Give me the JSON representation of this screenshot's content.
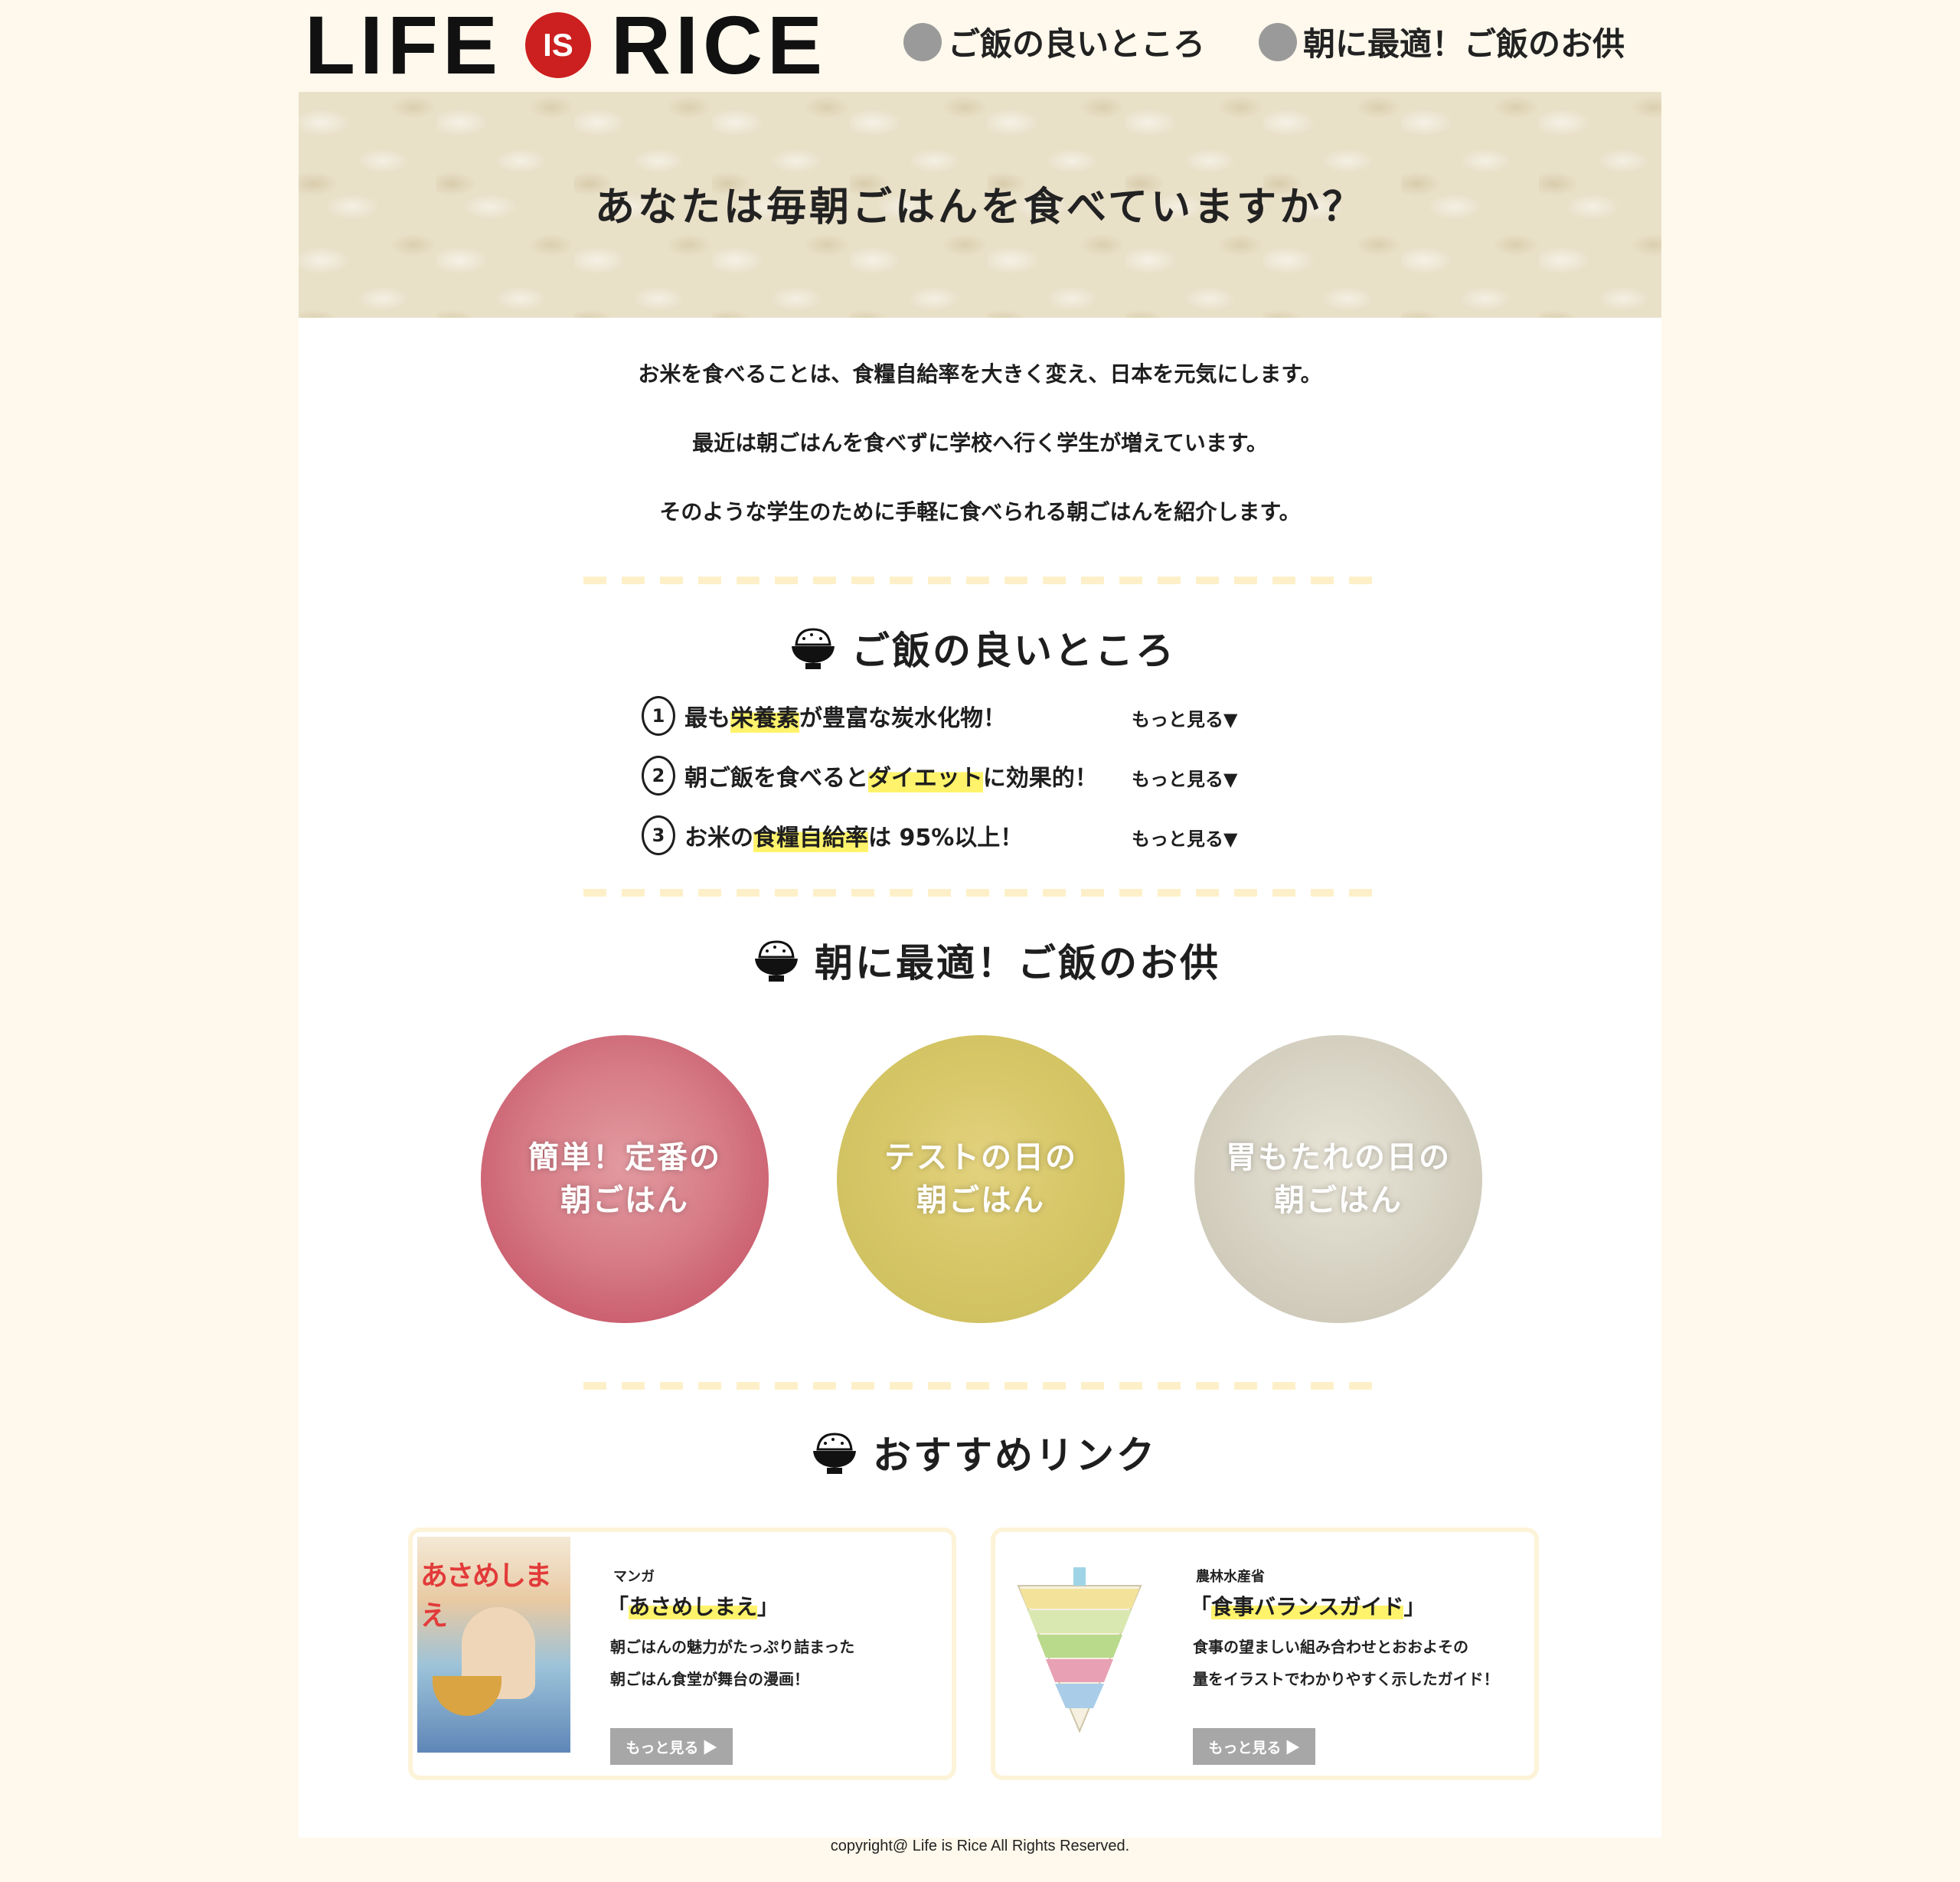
{
  "header": {
    "logo_left": "LIFE",
    "logo_is": "IS",
    "logo_right": "RICE",
    "nav": [
      "ご飯の良いところ",
      "朝に最適！ご飯のお供"
    ]
  },
  "hero": {
    "title": "あなたは毎朝ごはんを食べていますか？"
  },
  "intro": [
    "お米を食べることは、食糧自給率を大きく変え、日本を元気にします。",
    "最近は朝ごはんを食べずに学校へ行く学生が増えています。",
    "そのような学生のために手軽に食べられる朝ごはんを紹介します。"
  ],
  "good_points": {
    "heading": "ご飯の良いところ",
    "more_label": "もっと見る▼",
    "items": [
      {
        "num": "1",
        "pre": "最も",
        "highlight": "栄養素",
        "post": "が豊富な炭水化物！"
      },
      {
        "num": "2",
        "pre": "朝ご飯を食べると",
        "highlight": "ダイエット",
        "post": "に効果的！"
      },
      {
        "num": "3",
        "pre": "お米の",
        "highlight": "食糧自給率",
        "post": "は 95%以上！"
      }
    ]
  },
  "companions": {
    "heading": "朝に最適！ご飯のお供",
    "items": [
      {
        "line1": "簡単！定番の",
        "line2": "朝ごはん"
      },
      {
        "line1": "テストの日の",
        "line2": "朝ごはん"
      },
      {
        "line1": "胃もたれの日の",
        "line2": "朝ごはん"
      }
    ]
  },
  "links": {
    "heading": "おすすめリンク",
    "cards": [
      {
        "category": "マンガ",
        "title_open": "「",
        "title": "あさめしまえ",
        "title_close": "」",
        "desc1": "朝ごはんの魅力がたっぷり詰まった",
        "desc2": "朝ごはん食堂が舞台の漫画！",
        "thumb_text": "あさめしまえ",
        "button": "もっと見る ▶"
      },
      {
        "category": "農林水産省",
        "title_open": "「",
        "title": "食事バランスガイド",
        "title_close": "」",
        "desc1": "食事の望ましい組み合わせとおおよその",
        "desc2": "量をイラストでわかりやすく示したガイド！",
        "button": "もっと見る ▶"
      }
    ]
  },
  "footer": {
    "copyright": "copyright@ Life is Rice All Rights Reserved."
  },
  "colors": {
    "page_bg": "#fef9ec",
    "logo_red": "#cc1f1f",
    "highlight": "#fff36b",
    "nav_dot": "#9a9a9a",
    "button_gray": "#a7a7a7"
  },
  "icons": {
    "section_icon": "rice-bowl-icon",
    "nav_icon": "gray-dot-icon"
  }
}
